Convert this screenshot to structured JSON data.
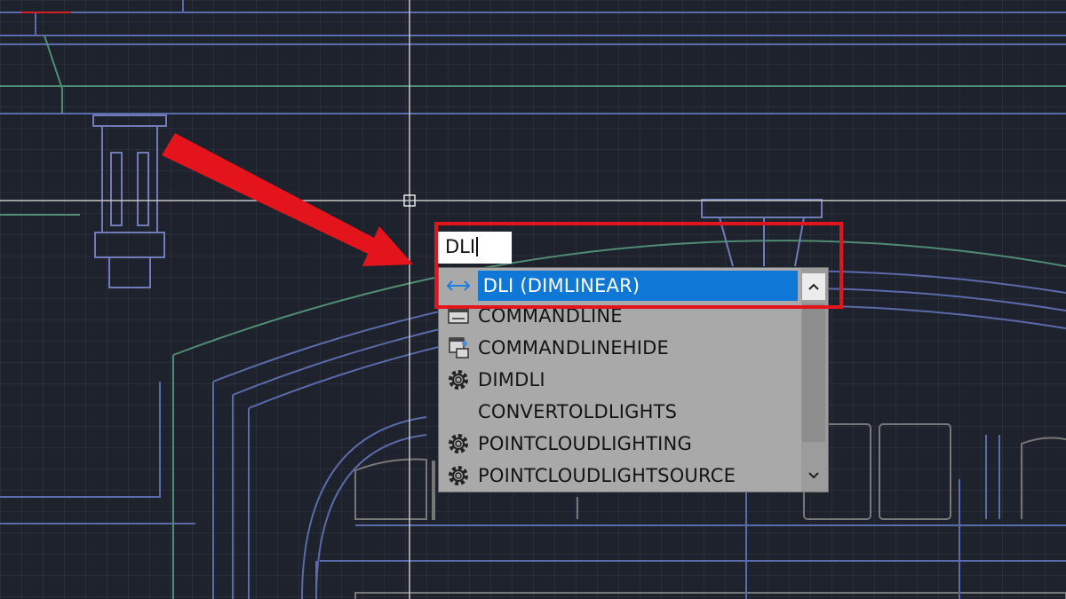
{
  "command_input": {
    "value": "DLI"
  },
  "autocomplete": {
    "items": [
      {
        "label": "DLI (DIMLINEAR)",
        "icon": "dimension-linear-icon",
        "selected": true
      },
      {
        "label": "COMMANDLINE",
        "icon": "command-window-icon",
        "selected": false
      },
      {
        "label": "COMMANDLINEHIDE",
        "icon": "command-window-hide-icon",
        "selected": false
      },
      {
        "label": "DIMDLI",
        "icon": "gear-icon",
        "selected": false
      },
      {
        "label": "CONVERTOLDLIGHTS",
        "icon": "",
        "selected": false
      },
      {
        "label": "POINTCLOUDLIGHTING",
        "icon": "gear-icon",
        "selected": false
      },
      {
        "label": "POINTCLOUDLIGHTSOURCE",
        "icon": "gear-icon",
        "selected": false
      }
    ]
  },
  "colors": {
    "canvas_bg": "#1e222d",
    "selection": "#0f78d7",
    "highlight": "#e3141b",
    "drawing_lines": "#5b6aa8",
    "drawing_green": "#4f8c73"
  }
}
